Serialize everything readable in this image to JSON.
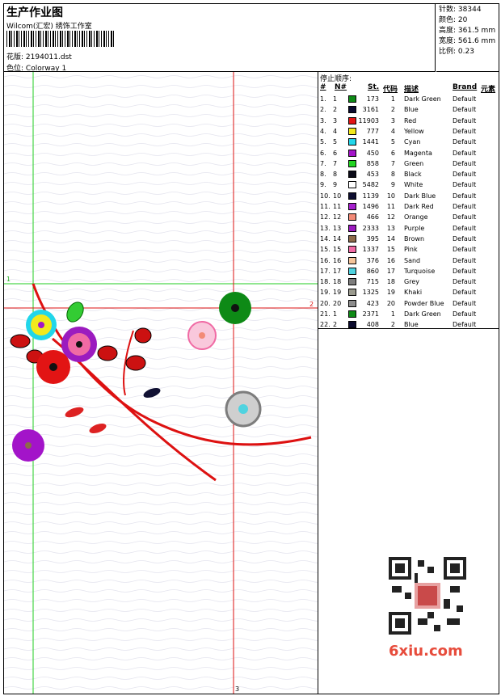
{
  "header": {
    "title": "生产作业图",
    "company": "Wilcom(汇宏) 绣饰工作室",
    "design_label": "花版:",
    "design_value": "2194011.dst",
    "colorway_label": "色位:",
    "colorway_value": "Colorway 1"
  },
  "stats": {
    "stitches_label": "针数:",
    "stitches_value": "38344",
    "colors_label": "颜色:",
    "colors_value": "20",
    "height_label": "高度:",
    "height_value": "361.5 mm",
    "width_label": "宽度:",
    "width_value": "561.6 mm",
    "scale_label": "比例:",
    "scale_value": "0.23"
  },
  "canvas": {
    "marker_1": "1",
    "marker_2": "2",
    "marker_3": "3"
  },
  "stop_table": {
    "title": "停止顺序:",
    "headers": {
      "num": "#",
      "n": "N#",
      "st": "St.",
      "code": "代码",
      "desc": "描述",
      "brand": "Brand",
      "element": "元素"
    },
    "rows": [
      {
        "num": "1.",
        "n": "1",
        "color": "#0e8a16",
        "st": "173",
        "code": "1",
        "desc": "Dark Green",
        "brand": "Default"
      },
      {
        "num": "2.",
        "n": "2",
        "color": "#0b0b2e",
        "st": "3161",
        "code": "2",
        "desc": "Blue",
        "brand": "Default"
      },
      {
        "num": "3.",
        "n": "3",
        "color": "#e21414",
        "st": "11903",
        "code": "3",
        "desc": "Red",
        "brand": "Default"
      },
      {
        "num": "4.",
        "n": "4",
        "color": "#f2e91c",
        "st": "777",
        "code": "4",
        "desc": "Yellow",
        "brand": "Default"
      },
      {
        "num": "5.",
        "n": "5",
        "color": "#21d6ea",
        "st": "1441",
        "code": "5",
        "desc": "Cyan",
        "brand": "Default"
      },
      {
        "num": "6.",
        "n": "6",
        "color": "#a314c9",
        "st": "450",
        "code": "6",
        "desc": "Magenta",
        "brand": "Default"
      },
      {
        "num": "7.",
        "n": "7",
        "color": "#22d422",
        "st": "858",
        "code": "7",
        "desc": "Green",
        "brand": "Default"
      },
      {
        "num": "8.",
        "n": "8",
        "color": "#0a0a18",
        "st": "453",
        "code": "8",
        "desc": "Black",
        "brand": "Default"
      },
      {
        "num": "9.",
        "n": "9",
        "color": "#ffffff",
        "st": "5482",
        "code": "9",
        "desc": "White",
        "brand": "Default"
      },
      {
        "num": "10.",
        "n": "10",
        "color": "#0d0d30",
        "st": "1139",
        "code": "10",
        "desc": "Dark Blue",
        "brand": "Default"
      },
      {
        "num": "11.",
        "n": "11",
        "color": "#a51fcd",
        "st": "1496",
        "code": "11",
        "desc": "Dark Red",
        "brand": "Default"
      },
      {
        "num": "12.",
        "n": "12",
        "color": "#f38a77",
        "st": "466",
        "code": "12",
        "desc": "Orange",
        "brand": "Default"
      },
      {
        "num": "13.",
        "n": "13",
        "color": "#9b1bbf",
        "st": "2333",
        "code": "13",
        "desc": "Purple",
        "brand": "Default"
      },
      {
        "num": "14.",
        "n": "14",
        "color": "#8d6a4a",
        "st": "395",
        "code": "14",
        "desc": "Brown",
        "brand": "Default"
      },
      {
        "num": "15.",
        "n": "15",
        "color": "#f06aa4",
        "st": "1337",
        "code": "15",
        "desc": "Pink",
        "brand": "Default"
      },
      {
        "num": "16.",
        "n": "16",
        "color": "#f5c49a",
        "st": "376",
        "code": "16",
        "desc": "Sand",
        "brand": "Default"
      },
      {
        "num": "17.",
        "n": "17",
        "color": "#4fd3e0",
        "st": "860",
        "code": "17",
        "desc": "Turquoise",
        "brand": "Default"
      },
      {
        "num": "18.",
        "n": "18",
        "color": "#7d7d7d",
        "st": "715",
        "code": "18",
        "desc": "Grey",
        "brand": "Default"
      },
      {
        "num": "19.",
        "n": "19",
        "color": "#9a9a8e",
        "st": "1325",
        "code": "19",
        "desc": "Khaki",
        "brand": "Default"
      },
      {
        "num": "20.",
        "n": "20",
        "color": "#8c8c8c",
        "st": "423",
        "code": "20",
        "desc": "Powder Blue",
        "brand": "Default"
      },
      {
        "num": "21.",
        "n": "1",
        "color": "#0e8a16",
        "st": "2371",
        "code": "1",
        "desc": "Dark Green",
        "brand": "Default"
      },
      {
        "num": "22.",
        "n": "2",
        "color": "#0b0b2e",
        "st": "408",
        "code": "2",
        "desc": "Blue",
        "brand": "Default"
      }
    ]
  },
  "watermark": {
    "logo_text": "6xiu.com"
  }
}
